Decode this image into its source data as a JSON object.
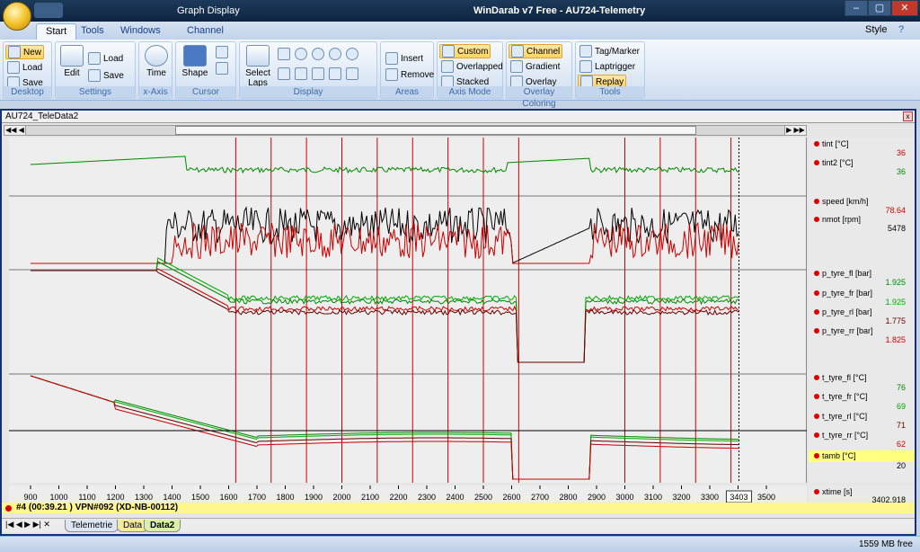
{
  "window": {
    "title": "WinDarab v7 Free - AU724-Telemetry",
    "context_title": "Graph Display",
    "minimize": "–",
    "maximize": "▢",
    "close": "✕"
  },
  "ribbon_tabs": [
    "Start",
    "Tools",
    "Windows",
    "Channel"
  ],
  "style_menu": "Style",
  "groups": {
    "desktop": {
      "caption": "Desktop",
      "new": "New",
      "load": "Load",
      "save": "Save"
    },
    "settings": {
      "caption": "Settings",
      "edit": "Edit",
      "load": "Load",
      "save": "Save"
    },
    "xaxis": {
      "caption": "x-Axis",
      "time": "Time"
    },
    "cursor": {
      "caption": "Cursor",
      "shape": "Shape"
    },
    "display": {
      "caption": "Display",
      "select_laps": "Select Laps"
    },
    "areas": {
      "caption": "Areas",
      "insert": "Insert",
      "remove": "Remove"
    },
    "axis_mode": {
      "caption": "Axis Mode",
      "custom": "Custom",
      "overlapped": "Overlapped",
      "stacked": "Stacked"
    },
    "overlay_coloring": {
      "caption": "Overlay Coloring",
      "channel": "Channel",
      "gradient": "Gradient",
      "overlay": "Overlay"
    },
    "tools": {
      "caption": "Tools",
      "tag_marker": "Tag/Marker",
      "laptrigger": "Laptrigger",
      "replay": "Replay"
    }
  },
  "document": {
    "title": "AU724_TeleData2"
  },
  "legend": [
    {
      "name": "tint [°C]",
      "value": "36",
      "color": "#cc0000"
    },
    {
      "name": "tint2 [°C]",
      "value": "36",
      "color": "#008800"
    },
    {
      "name": "speed [km/h]",
      "value": "78.64",
      "color": "#cc0000"
    },
    {
      "name": "nmot [rpm]",
      "value": "5478",
      "color": "#000000"
    },
    {
      "name": "p_tyre_fl [bar]",
      "value": "1.925",
      "color": "#008800"
    },
    {
      "name": "p_tyre_fr [bar]",
      "value": "1.925",
      "color": "#00aa00"
    },
    {
      "name": "p_tyre_rl [bar]",
      "value": "1.775",
      "color": "#660000"
    },
    {
      "name": "p_tyre_rr [bar]",
      "value": "1.825",
      "color": "#cc0000"
    },
    {
      "name": "t_tyre_fl [°C]",
      "value": "76",
      "color": "#008800"
    },
    {
      "name": "t_tyre_fr [°C]",
      "value": "69",
      "color": "#00aa00"
    },
    {
      "name": "t_tyre_rl [°C]",
      "value": "71",
      "color": "#660000"
    },
    {
      "name": "t_tyre_rr [°C]",
      "value": "62",
      "color": "#cc0000"
    },
    {
      "name": "tamb [°C]",
      "value": "20",
      "color": "#000000"
    },
    {
      "name": "xtime [s]",
      "value": "3402.918",
      "color": "#000000"
    }
  ],
  "xaxis": {
    "ticks": [
      "900",
      "1000",
      "1100",
      "1200",
      "1300",
      "1400",
      "1500",
      "1600",
      "1700",
      "1800",
      "1900",
      "2000",
      "2100",
      "2200",
      "2300",
      "2400",
      "2500",
      "2600",
      "2700",
      "2800",
      "2900",
      "3000",
      "3100",
      "3200",
      "3300",
      "3400",
      "3500"
    ],
    "cursor_label": "3403"
  },
  "lap_bar": "#4 (00:39.21  ) VPN#092 (XD-NB-00112)",
  "bottom_tabs": [
    "Telemetrie",
    "Data",
    "Data2"
  ],
  "status": {
    "memory": "1559 MB free"
  },
  "colors": {
    "accent": "#15307a",
    "lap_marker": "#cc0000",
    "ribbon_highlight": "#ffd35c",
    "legend_highlight": "#ffff80"
  }
}
